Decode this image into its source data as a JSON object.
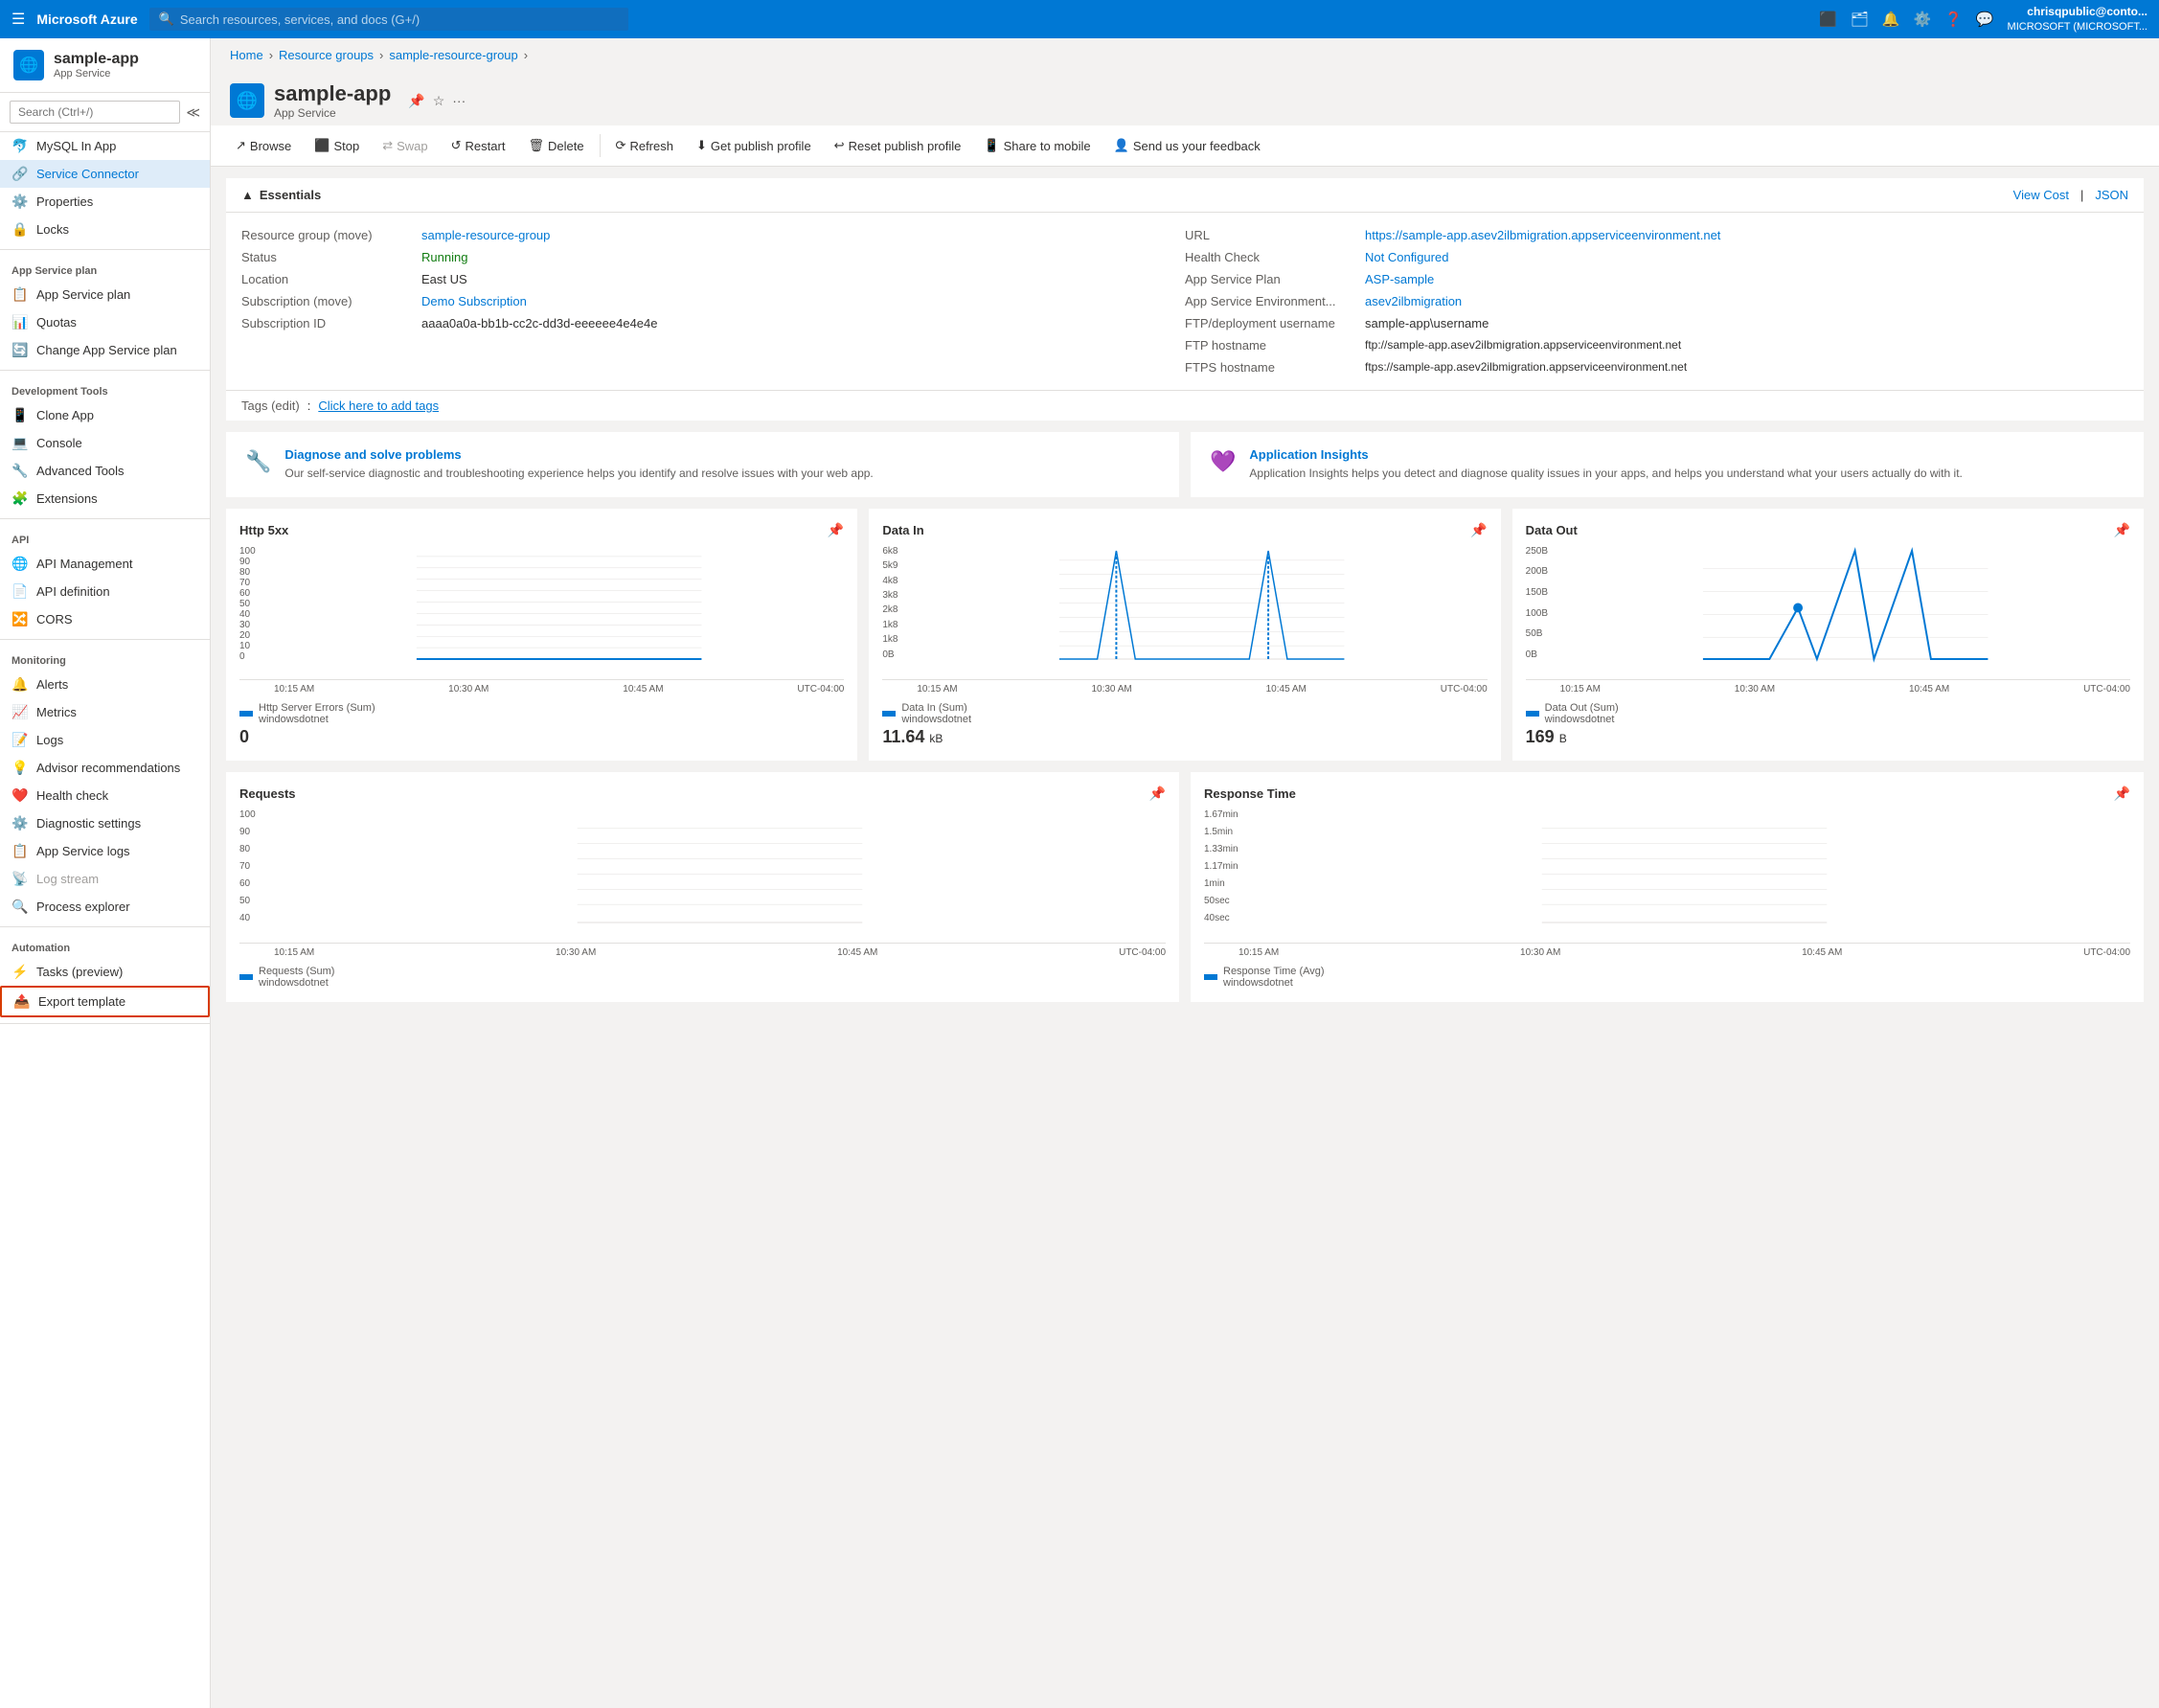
{
  "topnav": {
    "logo": "Microsoft Azure",
    "search_placeholder": "Search resources, services, and docs (G+/)",
    "user_name": "chrisqpublic@conto...",
    "user_org": "MICROSOFT (MICROSOFT..."
  },
  "breadcrumb": {
    "items": [
      "Home",
      "Resource groups",
      "sample-resource-group"
    ]
  },
  "page": {
    "title": "sample-app",
    "subtitle": "App Service",
    "icon": "🌐"
  },
  "toolbar": {
    "browse": "Browse",
    "stop": "Stop",
    "swap": "Swap",
    "restart": "Restart",
    "delete": "Delete",
    "refresh": "Refresh",
    "get_publish_profile": "Get publish profile",
    "reset_publish_profile": "Reset publish profile",
    "share_to_mobile": "Share to mobile",
    "feedback": "Send us your feedback"
  },
  "essentials": {
    "title": "Essentials",
    "view_cost": "View Cost",
    "json": "JSON",
    "left": [
      {
        "label": "Resource group (move)",
        "value": "sample-resource-group",
        "link": true
      },
      {
        "label": "Status",
        "value": "Running",
        "status": "running"
      },
      {
        "label": "Location",
        "value": "East US"
      },
      {
        "label": "Subscription (move)",
        "value": "Demo Subscription",
        "link": true
      },
      {
        "label": "Subscription ID",
        "value": "aaaa0a0a-bb1b-cc2c-dd3d-eeeeee4e4e4e"
      }
    ],
    "right": [
      {
        "label": "URL",
        "value": "https://sample-app.asev2ilbmigration.appserviceenvironment.net",
        "link": true
      },
      {
        "label": "Health Check",
        "value": "Not Configured",
        "link": true
      },
      {
        "label": "App Service Plan",
        "value": "ASP-sample",
        "link": true
      },
      {
        "label": "App Service Environment...",
        "value": "asev2ilbmigration",
        "link": true
      },
      {
        "label": "FTP/deployment username",
        "value": "sample-app\\username"
      },
      {
        "label": "FTP hostname",
        "value": "ftp://sample-app.asev2ilbmigration.appserviceenvironment.net"
      },
      {
        "label": "FTPS hostname",
        "value": "ftps://sample-app.asev2ilbmigration.appserviceenvironment.net"
      }
    ],
    "tags_label": "Tags (edit)",
    "tags_value": "Click here to add tags",
    "tags_link": true
  },
  "info_cards": [
    {
      "icon": "🔧",
      "title": "Diagnose and solve problems",
      "desc": "Our self-service diagnostic and troubleshooting experience helps you identify and resolve issues with your web app."
    },
    {
      "icon": "💜",
      "title": "Application Insights",
      "desc": "Application Insights helps you detect and diagnose quality issues in your apps, and helps you understand what your users actually do with it."
    }
  ],
  "charts_row1": [
    {
      "title": "Http 5xx",
      "yaxis": [
        "100",
        "90",
        "80",
        "70",
        "60",
        "50",
        "40",
        "30",
        "20",
        "10",
        "0"
      ],
      "xaxis": [
        "10:15 AM",
        "10:30 AM",
        "10:45 AM",
        "UTC-04:00"
      ],
      "legend_label": "Http Server Errors (Sum)",
      "legend_sub": "windowsdotnet",
      "value": "0",
      "value_unit": "",
      "type": "flat"
    },
    {
      "title": "Data In",
      "yaxis": [
        "6k8",
        "5k9",
        "4k8",
        "3k8",
        "2k8",
        "1k8",
        "1k8",
        "0B"
      ],
      "xaxis": [
        "10:15 AM",
        "10:30 AM",
        "10:45 AM",
        "UTC-04:00"
      ],
      "legend_label": "Data In (Sum)",
      "legend_sub": "windowsdotnet",
      "value": "11.64",
      "value_unit": "kB",
      "type": "spike"
    },
    {
      "title": "Data Out",
      "yaxis": [
        "250B",
        "200B",
        "150B",
        "100B",
        "50B",
        "0B"
      ],
      "xaxis": [
        "10:15 AM",
        "10:30 AM",
        "10:45 AM",
        "UTC-04:00"
      ],
      "legend_label": "Data Out (Sum)",
      "legend_sub": "windowsdotnet",
      "value": "169",
      "value_unit": "B",
      "type": "double-spike"
    }
  ],
  "charts_row2": [
    {
      "title": "Requests",
      "yaxis": [
        "100",
        "90",
        "80",
        "70",
        "60",
        "50",
        "40"
      ],
      "xaxis": [
        "10:15 AM",
        "10:30 AM",
        "10:45 AM",
        "UTC-04:00"
      ],
      "legend_label": "Requests (Sum)",
      "legend_sub": "windowsdotnet",
      "value": "",
      "value_unit": "",
      "type": "flat"
    },
    {
      "title": "Response Time",
      "yaxis": [
        "1.67min",
        "1.5min",
        "1.33min",
        "1.17min",
        "1min",
        "50sec",
        "40sec"
      ],
      "xaxis": [
        "10:15 AM",
        "10:30 AM",
        "10:45 AM",
        "UTC-04:00"
      ],
      "legend_label": "Response Time (Avg)",
      "legend_sub": "windowsdotnet",
      "value": "",
      "value_unit": "",
      "type": "flat"
    }
  ],
  "sidebar": {
    "search_placeholder": "Search (Ctrl+/)",
    "sections": [
      {
        "title": null,
        "items": [
          {
            "icon": "🐬",
            "label": "MySQL In App"
          },
          {
            "icon": "🔗",
            "label": "Service Connector",
            "active": true
          },
          {
            "icon": "⚙️",
            "label": "Properties"
          },
          {
            "icon": "🔒",
            "label": "Locks"
          }
        ]
      },
      {
        "title": "App Service plan",
        "items": [
          {
            "icon": "📋",
            "label": "App Service plan"
          },
          {
            "icon": "📊",
            "label": "Quotas"
          },
          {
            "icon": "🔄",
            "label": "Change App Service plan"
          }
        ]
      },
      {
        "title": "Development Tools",
        "items": [
          {
            "icon": "📱",
            "label": "Clone App"
          },
          {
            "icon": "💻",
            "label": "Console"
          },
          {
            "icon": "🔧",
            "label": "Advanced Tools"
          },
          {
            "icon": "🧩",
            "label": "Extensions"
          }
        ]
      },
      {
        "title": "API",
        "items": [
          {
            "icon": "🌐",
            "label": "API Management"
          },
          {
            "icon": "📄",
            "label": "API definition"
          },
          {
            "icon": "🔀",
            "label": "CORS"
          }
        ]
      },
      {
        "title": "Monitoring",
        "items": [
          {
            "icon": "🔔",
            "label": "Alerts"
          },
          {
            "icon": "📈",
            "label": "Metrics"
          },
          {
            "icon": "📝",
            "label": "Logs"
          },
          {
            "icon": "💡",
            "label": "Advisor recommendations"
          },
          {
            "icon": "❤️",
            "label": "Health check"
          },
          {
            "icon": "⚙️",
            "label": "Diagnostic settings"
          },
          {
            "icon": "📋",
            "label": "App Service logs"
          },
          {
            "icon": "📡",
            "label": "Log stream",
            "disabled": true
          },
          {
            "icon": "🔍",
            "label": "Process explorer"
          }
        ]
      },
      {
        "title": "Automation",
        "items": [
          {
            "icon": "⚡",
            "label": "Tasks (preview)"
          },
          {
            "icon": "📤",
            "label": "Export template",
            "highlighted": true
          }
        ]
      }
    ]
  }
}
